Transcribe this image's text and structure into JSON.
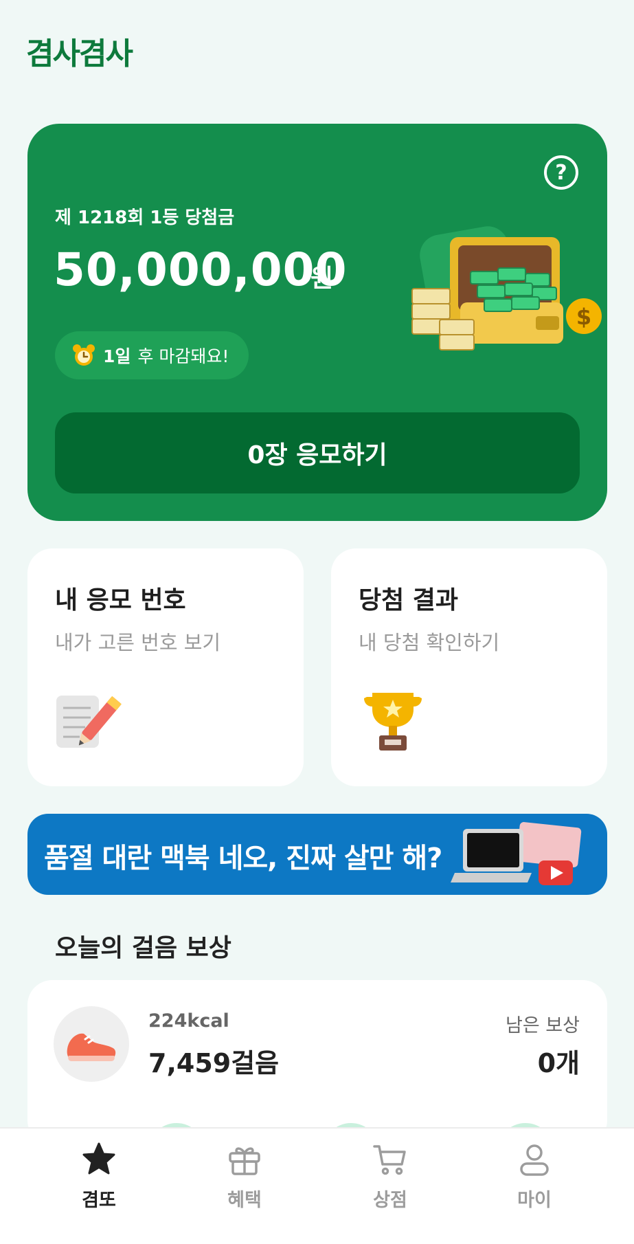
{
  "app": {
    "logo": "겸사겸사"
  },
  "lottery": {
    "round_label": "제 1218회 1등 당첨금",
    "amount": "50,000,000",
    "unit": "원",
    "deadline_bold": "1일",
    "deadline_rest": "후 마감돼요!",
    "apply_button": "0장 응모하기",
    "help_icon": "question-circle-icon"
  },
  "cards": [
    {
      "title": "내 응모 번호",
      "subtitle": "내가 고른 번호 보기",
      "icon": "notepad-pencil-icon"
    },
    {
      "title": "당첨 결과",
      "subtitle": "내 당첨 확인하기",
      "icon": "trophy-icon"
    }
  ],
  "banner": {
    "text": "품절 대란 맥북 네오, 진짜 살만 해?",
    "icon": "laptop-video-icon"
  },
  "steps": {
    "section_title": "오늘의 걸음 보상",
    "kcal": "224kcal",
    "count": "7,459걸음",
    "remaining_label": "남은 보상",
    "remaining_count": "0개",
    "icon": "sneaker-icon"
  },
  "nav": [
    {
      "label": "겸또",
      "icon": "star-icon",
      "active": true
    },
    {
      "label": "혜택",
      "icon": "gift-icon",
      "active": false
    },
    {
      "label": "상점",
      "icon": "cart-icon",
      "active": false
    },
    {
      "label": "마이",
      "icon": "person-icon",
      "active": false
    }
  ],
  "colors": {
    "brand": "#148e4d",
    "brand_dark": "#036a31",
    "banner": "#0d78c4",
    "logo": "#0d7a3c"
  }
}
